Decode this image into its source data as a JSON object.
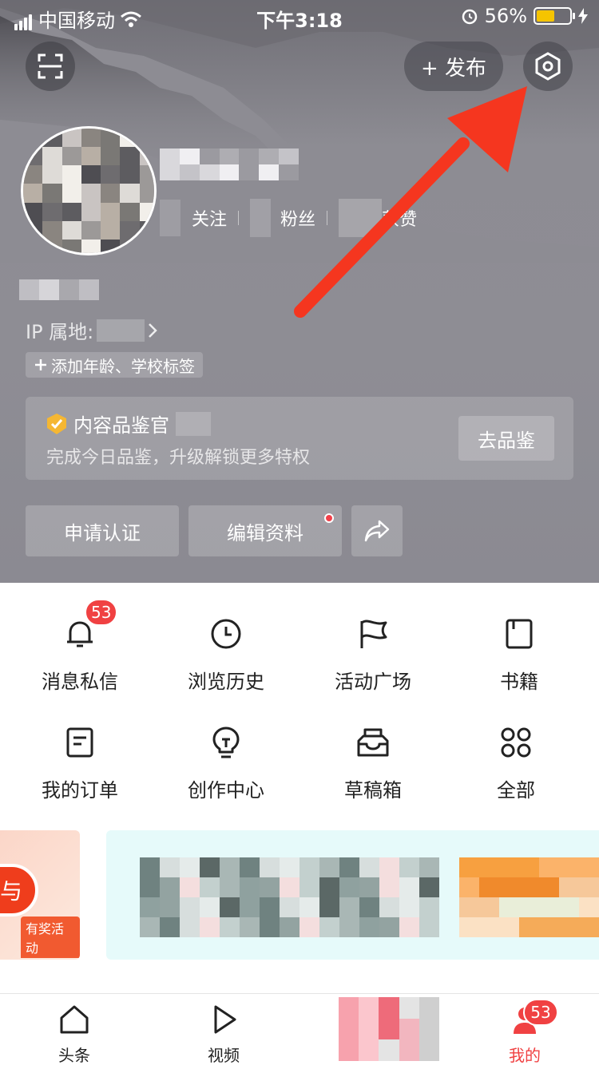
{
  "status_bar": {
    "carrier": "中国移动",
    "time": "下午3:18",
    "battery": "56%",
    "battery_level": 0.56
  },
  "header": {
    "publish_label": "+ 发布",
    "scan_icon": "scan-icon",
    "settings_icon": "settings-hexagon-icon"
  },
  "profile": {
    "follow_label": "关注",
    "fans_label": "粉丝",
    "likes_label": "获赞",
    "ip_label": "IP 属地:",
    "add_tag_label": "添加年龄、学校标签"
  },
  "curator": {
    "title": "内容品鉴官",
    "description": "完成今日品鉴，升级解锁更多特权",
    "button": "去品鉴"
  },
  "actions": {
    "verify": "申请认证",
    "edit_profile": "编辑资料",
    "share_icon": "share-icon"
  },
  "menu": {
    "items": [
      {
        "label": "消息私信",
        "icon": "bell-icon",
        "badge": "53"
      },
      {
        "label": "浏览历史",
        "icon": "clock-icon"
      },
      {
        "label": "活动广场",
        "icon": "flag-icon"
      },
      {
        "label": "书籍",
        "icon": "book-icon"
      },
      {
        "label": "我的订单",
        "icon": "order-icon"
      },
      {
        "label": "创作中心",
        "icon": "lightbulb-icon"
      },
      {
        "label": "草稿箱",
        "icon": "inbox-icon"
      },
      {
        "label": "全部",
        "icon": "grid-icon"
      }
    ]
  },
  "banner": {
    "left_pill": "与",
    "prize_label": "有奖活动"
  },
  "tabbar": {
    "tabs": [
      {
        "label": "头条",
        "icon": "home-icon"
      },
      {
        "label": "视频",
        "icon": "play-icon"
      },
      {
        "label": "我的",
        "icon": "me-icon",
        "badge": "53"
      }
    ]
  },
  "colors": {
    "accent_red": "#f04142",
    "annotation_arrow": "#f5361f",
    "header_gray": "#8d8c93"
  }
}
